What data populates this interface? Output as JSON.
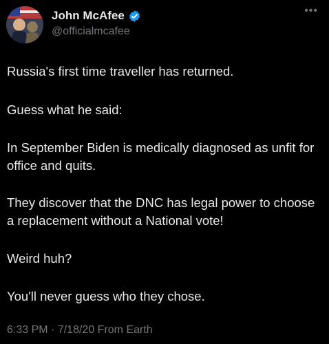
{
  "author": {
    "display_name": "John McAfee",
    "handle": "@officialmcafee",
    "verified": true,
    "verified_color": "#1d9bf0"
  },
  "more_menu_icon": "ellipsis-icon",
  "tweet": {
    "paragraphs": [
      "Russia's first time traveller has returned.",
      "Guess what he said:",
      "In September Biden is medically diagnosed as unfit for office and quits.",
      "They discover that the DNC has legal power to choose a replacement without a National vote!",
      "Weird huh?",
      "You'll never guess who they chose."
    ]
  },
  "meta": {
    "time": "6:33 PM",
    "separator": "·",
    "date": "7/18/20",
    "source": "From Earth"
  },
  "colors": {
    "background": "#000000",
    "primary_text": "#e7e9ea",
    "secondary_text": "#71767b"
  }
}
